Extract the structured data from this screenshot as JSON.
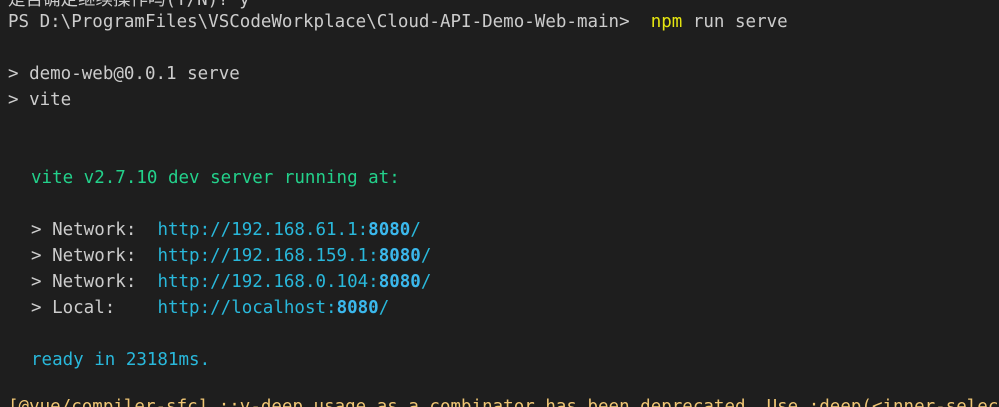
{
  "terminal": {
    "top_cut_text": "是否确定继续操作吗(Y/N)? y",
    "prompt": {
      "path": "PS D:\\ProgramFiles\\VSCodeWorkplace\\Cloud-API-Demo-Web-main> ",
      "command_npm": "npm",
      "command_rest": " run serve"
    },
    "script_lines": [
      "> demo-web@0.0.1 serve",
      "> vite"
    ],
    "vite_banner": "vite v2.7.10 dev server running at:",
    "addresses": [
      {
        "label": "> Network:  ",
        "url_prefix": "http://192.168.61.1:",
        "port": "8080",
        "url_suffix": "/"
      },
      {
        "label": "> Network:  ",
        "url_prefix": "http://192.168.159.1:",
        "port": "8080",
        "url_suffix": "/"
      },
      {
        "label": "> Network:  ",
        "url_prefix": "http://192.168.0.104:",
        "port": "8080",
        "url_suffix": "/"
      },
      {
        "label": "> Local:    ",
        "url_prefix": "http://localhost:",
        "port": "8080",
        "url_suffix": "/"
      }
    ],
    "ready_text": "ready in 23181ms.",
    "bottom_cut_text": "[@vue/compiler-sfc] ::v-deep usage as a combinator has been deprecated. Use :deep(<inner-selector>) instead."
  },
  "colors": {
    "background": "#1e1e1e",
    "foreground": "#cccccc",
    "npm_yellow": "#e5e510",
    "vite_green": "#23d18b",
    "url_cyan": "#29b8db"
  }
}
